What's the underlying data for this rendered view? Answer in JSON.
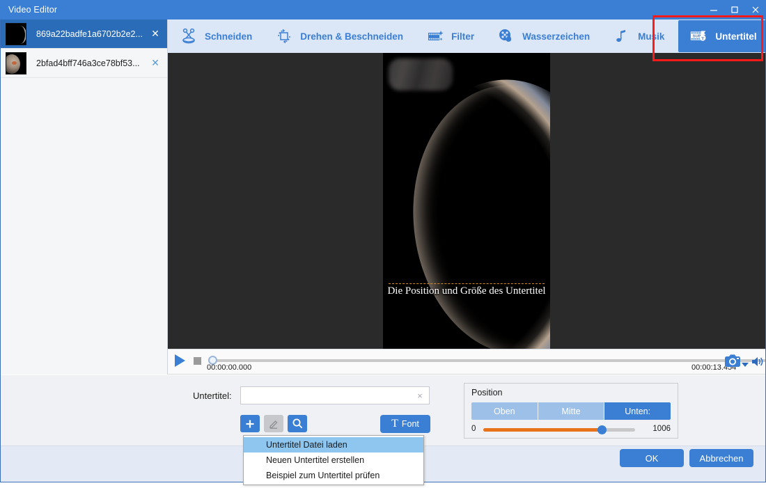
{
  "window": {
    "title": "Video Editor",
    "controls": {
      "minimize": "minimize-icon",
      "maximize": "maximize-icon",
      "close": "close-icon"
    }
  },
  "toolbar": {
    "items": [
      {
        "label": "Schneiden",
        "icon": "scissors-icon",
        "active": false
      },
      {
        "label": "Drehen & Beschneiden",
        "icon": "crop-rotate-icon",
        "active": false
      },
      {
        "label": "Filter",
        "icon": "film-sparkle-icon",
        "active": false
      },
      {
        "label": "Wasserzeichen",
        "icon": "watermark-droplet-icon",
        "active": false
      },
      {
        "label": "Musik",
        "icon": "music-note-icon",
        "active": false
      },
      {
        "label": "Untertitel",
        "icon": "subtitle-sub-icon",
        "active": true
      }
    ],
    "highlight_color": "#ff1a1a",
    "accent_color": "#3b7fd4"
  },
  "sidebar": {
    "files": [
      {
        "name": "869a22badfe1a6702b2e2...",
        "selected": true
      },
      {
        "name": "2bfad4bff746a3ce78bf53...",
        "selected": false
      }
    ],
    "close_glyph": "✕"
  },
  "preview": {
    "subtitle_overlay_text": "Die Position und Größe des Untertitel",
    "guide_color": "#d98c22"
  },
  "transport": {
    "play_icon": "play-icon",
    "stop_icon": "stop-icon",
    "current_time": "00:00:00.000",
    "total_time": "00:00:13.454",
    "snapshot_icon": "camera-icon",
    "snapshot_dropdown_icon": "caret-down-icon",
    "volume_icon": "volume-icon"
  },
  "subtitle_panel": {
    "field_label": "Untertitel:",
    "field_value": "",
    "field_placeholder": "",
    "clear_glyph": "×",
    "add_button": "+",
    "edit_button": "pencil-icon",
    "search_button": "magnifier-icon",
    "font_button": "Font",
    "font_glyph": "T",
    "menu": {
      "items": [
        {
          "label": "Untertitel Datei laden",
          "highlighted": true
        },
        {
          "label": "Neuen Untertitel erstellen",
          "highlighted": false
        },
        {
          "label": "Beispiel zum Untertitel prüfen",
          "highlighted": false
        }
      ]
    }
  },
  "position_panel": {
    "group_label": "Position",
    "options": [
      {
        "label": "Oben",
        "active": false
      },
      {
        "label": "Mitte",
        "active": false
      },
      {
        "label": "Unten:",
        "active": true
      }
    ],
    "slider": {
      "min_label": "0",
      "max_label": "1006",
      "min": 0,
      "max": 1006,
      "value": 785,
      "fill_color": "#e8731a"
    }
  },
  "footer": {
    "ok_label": "OK",
    "cancel_label": "Abbrechen"
  }
}
